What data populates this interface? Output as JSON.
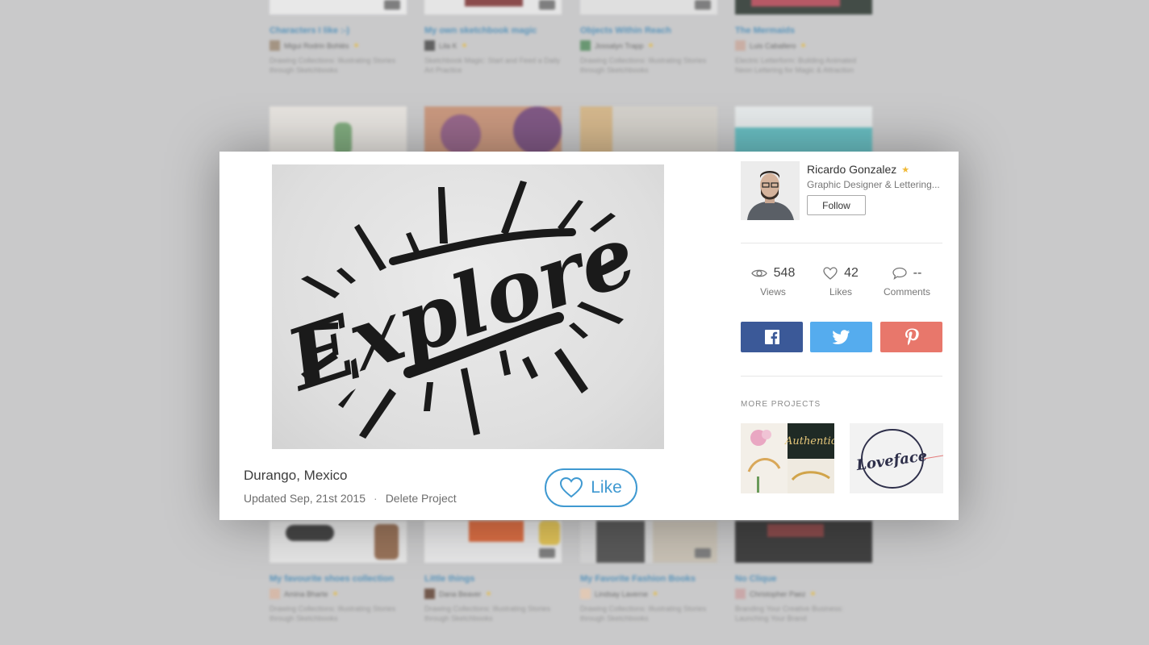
{
  "background": {
    "cards": [
      {
        "title": "Characters I like :-)",
        "author": "Migui Rodrin Bohlés",
        "desc": "Drawing Collections: Illustrating Stories through Sketchbooks"
      },
      {
        "title": "My own sketchbook magic",
        "author": "Lila K",
        "desc": "Sketchbook Magic: Start and Feed a Daily Art Practice"
      },
      {
        "title": "Objects Within Reach",
        "author": "Jossalyn Trapp",
        "desc": "Drawing Collections: Illustrating Stories through Sketchbooks"
      },
      {
        "title": "The Mermaids",
        "author": "Luis Caballero",
        "desc": "Electric Letterform: Building Animated Neon Lettering for Magic & Attraction"
      },
      {
        "title": "My favourite shoes collection",
        "author": "Amina Bharte",
        "desc": "Drawing Collections: Illustrating Stories through Sketchbooks"
      },
      {
        "title": "Little things",
        "author": "Dana Beaver",
        "desc": "Drawing Collections: Illustrating Stories through Sketchbooks"
      },
      {
        "title": "My Favorite Fashion Books",
        "author": "Lindsay Laverne",
        "desc": "Drawing Collections: Illustrating Stories through Sketchbooks"
      },
      {
        "title": "No Clique",
        "author": "Christopher Paez",
        "desc": "Branding Your Creative Business: Launching Your Brand"
      }
    ]
  },
  "project": {
    "artwork_word": "Explore",
    "location": "Durango, Mexico",
    "updated": "Updated Sep, 21st 2015",
    "separator": "·",
    "delete_label": "Delete Project",
    "like_label": "Like"
  },
  "author": {
    "name": "Ricardo Gonzalez",
    "title": "Graphic Designer & Lettering...",
    "follow_label": "Follow"
  },
  "stats": {
    "views": "548",
    "views_label": "Views",
    "likes": "42",
    "likes_label": "Likes",
    "comments": "--",
    "comments_label": "Comments"
  },
  "share": {
    "facebook_color": "#3b5998",
    "twitter_color": "#55acee",
    "pinterest_color": "#e8776b"
  },
  "more_projects": {
    "label": "MORE PROJECTS",
    "items": [
      {
        "thumb_text": "Authentic"
      },
      {
        "thumb_text": "Loveface"
      }
    ]
  }
}
